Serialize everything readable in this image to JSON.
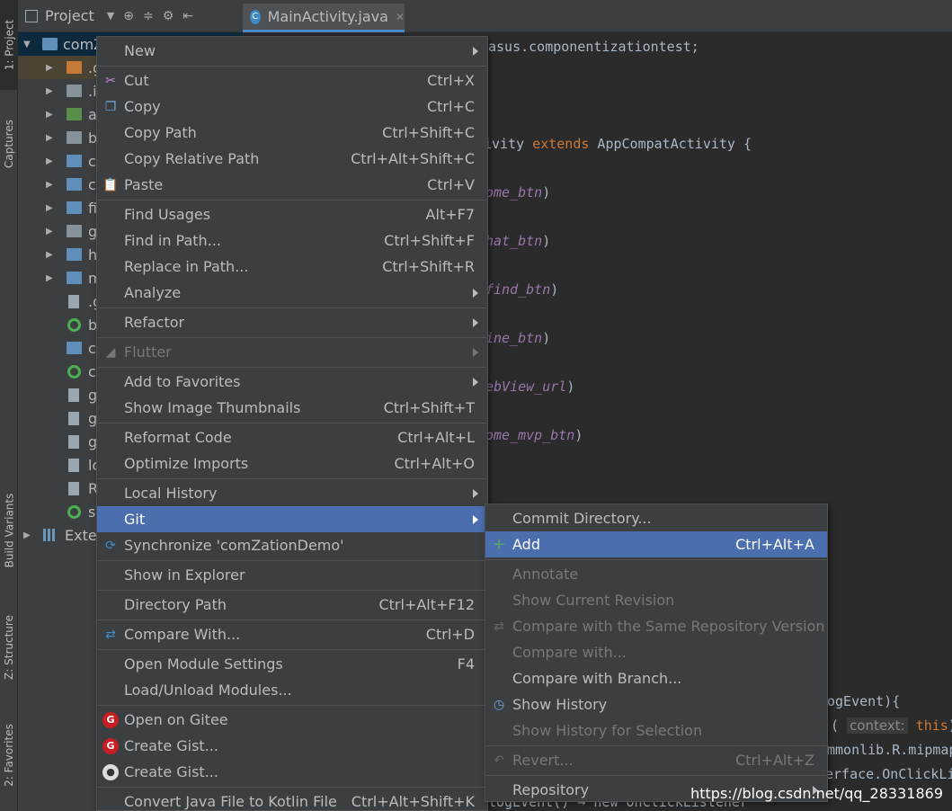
{
  "left_strip": {
    "tabs": [
      "1: Project",
      "Captures",
      "Build Variants",
      "Z: Structure",
      "2: Favorites"
    ]
  },
  "project_toolbar": {
    "label": "Project"
  },
  "tree": {
    "rows": [
      "comZ",
      ".g",
      ".i",
      "a",
      "b",
      "c",
      "c",
      "fi",
      "g",
      "h",
      "m",
      ".g",
      "b",
      "c",
      "c",
      "g",
      "g",
      "g",
      "lo",
      "R",
      "se",
      "Exter"
    ]
  },
  "editor": {
    "tab_label": "MainActivity.java",
    "lines": {
      "l1": "asus.componentizationtest;",
      "l2a": "ivity ",
      "l2kw": "extends",
      "l2b": " AppCompatActivity {",
      "f1": "ome_btn",
      "f2": "hat_btn",
      "f3": "find_btn",
      "f4": "ine_btn",
      "f5": "ebView_url",
      "f6": "ome_mvp_btn",
      "close_paren": ")",
      "l_log": "ogEvent){",
      "l_ctx_open": "( ",
      "l_ctx_hint": "context:",
      "l_ctx_this": "this",
      "l_ctx_close": ")",
      "l_mipmap": "mmonlib.R.mipmap",
      "l_onclick": "erface.OnClickLi",
      "l_bottom": "logEvent() → new OnClickListener"
    }
  },
  "context_menu": {
    "items": [
      {
        "label": "New",
        "shortcut": "",
        "submenu": true
      },
      {
        "label": "Cut",
        "shortcut": "Ctrl+X",
        "icon": "scissors-icon"
      },
      {
        "label": "Copy",
        "shortcut": "Ctrl+C",
        "icon": "copy-icon"
      },
      {
        "label": "Copy Path",
        "shortcut": "Ctrl+Shift+C"
      },
      {
        "label": "Copy Relative Path",
        "shortcut": "Ctrl+Alt+Shift+C"
      },
      {
        "label": "Paste",
        "shortcut": "Ctrl+V",
        "icon": "paste-icon"
      },
      {
        "label": "Find Usages",
        "shortcut": "Alt+F7"
      },
      {
        "label": "Find in Path...",
        "shortcut": "Ctrl+Shift+F"
      },
      {
        "label": "Replace in Path...",
        "shortcut": "Ctrl+Shift+R"
      },
      {
        "label": "Analyze",
        "shortcut": "",
        "submenu": true
      },
      {
        "label": "Refactor",
        "shortcut": "",
        "submenu": true
      },
      {
        "label": "Flutter",
        "shortcut": "",
        "submenu": true,
        "disabled": true
      },
      {
        "label": "Add to Favorites",
        "shortcut": "",
        "submenu": true
      },
      {
        "label": "Show Image Thumbnails",
        "shortcut": "Ctrl+Shift+T"
      },
      {
        "label": "Reformat Code",
        "shortcut": "Ctrl+Alt+L"
      },
      {
        "label": "Optimize Imports",
        "shortcut": "Ctrl+Alt+O"
      },
      {
        "label": "Local History",
        "shortcut": "",
        "submenu": true
      },
      {
        "label": "Git",
        "shortcut": "",
        "submenu": true,
        "selected": true
      },
      {
        "label": "Synchronize 'comZationDemo'",
        "shortcut": "",
        "icon": "sync-icon"
      },
      {
        "label": "Show in Explorer",
        "shortcut": ""
      },
      {
        "label": "Directory Path",
        "shortcut": "Ctrl+Alt+F12"
      },
      {
        "label": "Compare With...",
        "shortcut": "Ctrl+D",
        "icon": "compare-icon"
      },
      {
        "label": "Open Module Settings",
        "shortcut": "F4"
      },
      {
        "label": "Load/Unload Modules...",
        "shortcut": ""
      },
      {
        "label": "Open on Gitee",
        "shortcut": "",
        "icon": "gitee-icon"
      },
      {
        "label": "Create Gist...",
        "shortcut": "",
        "icon": "gitee-icon"
      },
      {
        "label": "Create Gist...",
        "shortcut": "",
        "icon": "github-icon"
      },
      {
        "label": "Convert Java File to Kotlin File",
        "shortcut": "Ctrl+Alt+Shift+K"
      }
    ]
  },
  "git_submenu": {
    "items": [
      {
        "label": "Commit Directory...",
        "shortcut": ""
      },
      {
        "label": "Add",
        "shortcut": "Ctrl+Alt+A",
        "selected": true,
        "icon": "plus-icon"
      },
      {
        "label": "Annotate",
        "shortcut": "",
        "disabled": true
      },
      {
        "label": "Show Current Revision",
        "shortcut": "",
        "disabled": true
      },
      {
        "label": "Compare with the Same Repository Version",
        "shortcut": "",
        "disabled": true,
        "icon": "compare-icon"
      },
      {
        "label": "Compare with...",
        "shortcut": "",
        "disabled": true
      },
      {
        "label": "Compare with Branch...",
        "shortcut": ""
      },
      {
        "label": "Show History",
        "shortcut": "",
        "icon": "history-icon"
      },
      {
        "label": "Show History for Selection",
        "shortcut": "",
        "disabled": true
      },
      {
        "label": "Revert...",
        "shortcut": "Ctrl+Alt+Z",
        "disabled": true,
        "icon": "revert-icon"
      },
      {
        "label": "Repository",
        "shortcut": "",
        "submenu": true
      }
    ]
  },
  "watermark": "https://blog.csdn.net/qq_28331869"
}
